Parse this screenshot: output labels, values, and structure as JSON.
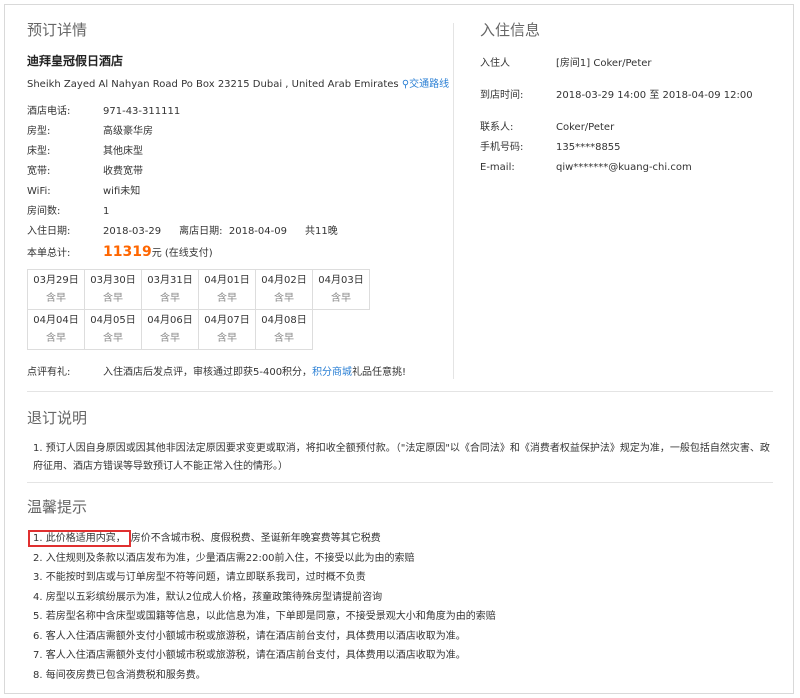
{
  "booking": {
    "title": "预订详情",
    "hotel_name": "迪拜皇冠假日酒店",
    "address": "Sheikh Zayed Al Nahyan Road Po Box 23215 Dubai , United Arab Emirates",
    "map_link": "交通路线",
    "phone_label": "酒店电话:",
    "phone": "971-43-311111",
    "room_type_label": "房型:",
    "room_type": "高级豪华房",
    "bed_type_label": "床型:",
    "bed_type": "其他床型",
    "broadband_label": "宽带:",
    "broadband": "收费宽带",
    "wifi_label": "WiFi:",
    "wifi": "wifi未知",
    "rooms_label": "房间数:",
    "rooms": "1",
    "checkin_date_label": "入住日期:",
    "checkin_date": "2018-03-29",
    "checkout_date_label": "离店日期:",
    "checkout_date": "2018-04-09",
    "nights": "共11晚",
    "total_label": "本单总计:",
    "total_amount": "11319",
    "total_suffix": "元 (在线支付)",
    "calendar": [
      {
        "date": "03月29日",
        "meal": "含早"
      },
      {
        "date": "03月30日",
        "meal": "含早"
      },
      {
        "date": "03月31日",
        "meal": "含早"
      },
      {
        "date": "04月01日",
        "meal": "含早"
      },
      {
        "date": "04月02日",
        "meal": "含早"
      },
      {
        "date": "04月03日",
        "meal": "含早"
      },
      {
        "date": "04月04日",
        "meal": "含早"
      },
      {
        "date": "04月05日",
        "meal": "含早"
      },
      {
        "date": "04月06日",
        "meal": "含早"
      },
      {
        "date": "04月07日",
        "meal": "含早"
      },
      {
        "date": "04月08日",
        "meal": "含早"
      }
    ],
    "review_label": "点评有礼:",
    "review_text": "入住酒店后发点评，审核通过即获5-400积分，",
    "review_link": "积分商城",
    "review_suffix": "礼品任意挑!"
  },
  "checkin": {
    "title": "入住信息",
    "guest_label": "入住人",
    "guest": "[房间1] Coker/Peter",
    "arrival_label": "到店时间:",
    "arrival_from": "2018-03-29 14:00",
    "arrival_to_word": "至",
    "arrival_to": "2018-04-09 12:00",
    "contact_label": "联系人:",
    "contact": "Coker/Peter",
    "mobile_label": "手机号码:",
    "mobile": "135****8855",
    "email_label": "E-mail:",
    "email": "qiw*******@kuang-chi.com"
  },
  "refund": {
    "title": "退订说明",
    "text": "1. 预订人因自身原因或因其他非因法定原因要求变更或取消，将扣收全额预付款。（\"法定原因\"以《合同法》和《消费者权益保护法》规定为准，一般包括自然灾害、政府征用、酒店方错误等导致预订人不能正常入住的情形。）"
  },
  "tips": {
    "title": "温馨提示",
    "item1_highlight": "1. 此价格适用内宾，",
    "item1_rest": "房价不含城市税、度假税费、圣诞新年晚宴费等其它税费",
    "items": [
      "2. 入住规则及条款以酒店发布为准，少量酒店需22:00前入住，不接受以此为由的索赔",
      "3. 不能按时到店或与订单房型不符等问题，请立即联系我司，过时概不负责",
      "4. 房型以五彩缤纷展示为准，默认2位成人价格，孩童政策待殊房型请提前咨询",
      "5. 若房型名称中含床型或国籍等信息，以此信息为准，下单即是同意，不接受景观大小和角度为由的索赔",
      "6. 客人入住酒店需额外支付小额城市税或旅游税，请在酒店前台支付，具体费用以酒店收取为准。",
      "7. 客人入住酒店需额外支付小额城市税或旅游税，请在酒店前台支付，具体费用以酒店收取为准。",
      "8. 每间夜房费已包含消费税和服务费。"
    ]
  }
}
